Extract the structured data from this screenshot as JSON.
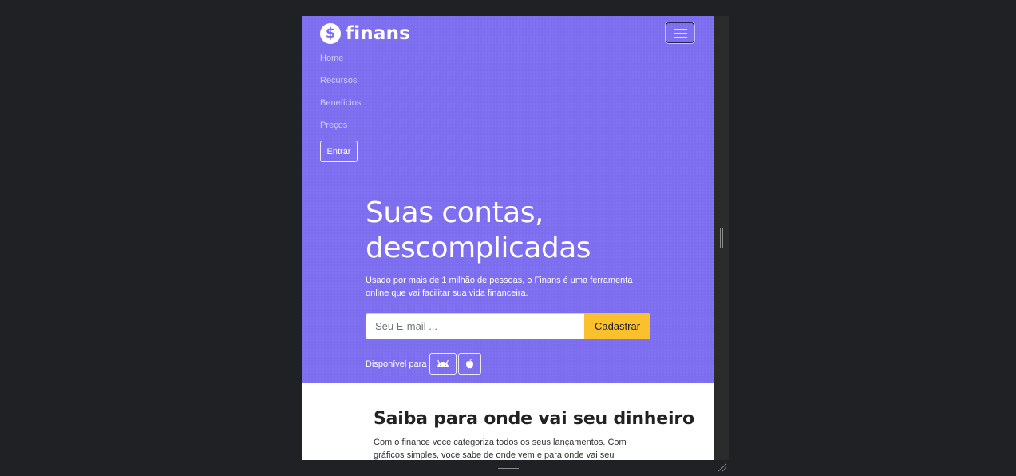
{
  "brand": {
    "icon_symbol": "$",
    "name": "finans"
  },
  "nav": {
    "toggler_icon": "hamburger-menu-icon",
    "items": [
      "Home",
      "Recursos",
      "Benefícios",
      "Preços"
    ],
    "login_label": "Entrar"
  },
  "hero": {
    "headline_line1": "Suas contas,",
    "headline_line2": "descomplicadas",
    "subtitle": "Usado por mais de 1 milhão de pessoas, o Finans é uma ferramenta online que vai facilitar sua vida financeira.",
    "email_placeholder": "Seu E-mail ...",
    "signup_label": "Cadastrar",
    "available_label": "Disponível para",
    "platforms": [
      "android-icon",
      "apple-icon"
    ]
  },
  "features": {
    "title": "Saiba para onde vai seu dinheiro",
    "text": "Com o finance voce categoriza todos os seus lançamentos. Com gráficos simples, voce sabe de onde vem e para onde vai seu"
  },
  "colors": {
    "hero_background": "#7d6ef0",
    "signup_button": "#fbc02d",
    "page_background": "#202124"
  }
}
